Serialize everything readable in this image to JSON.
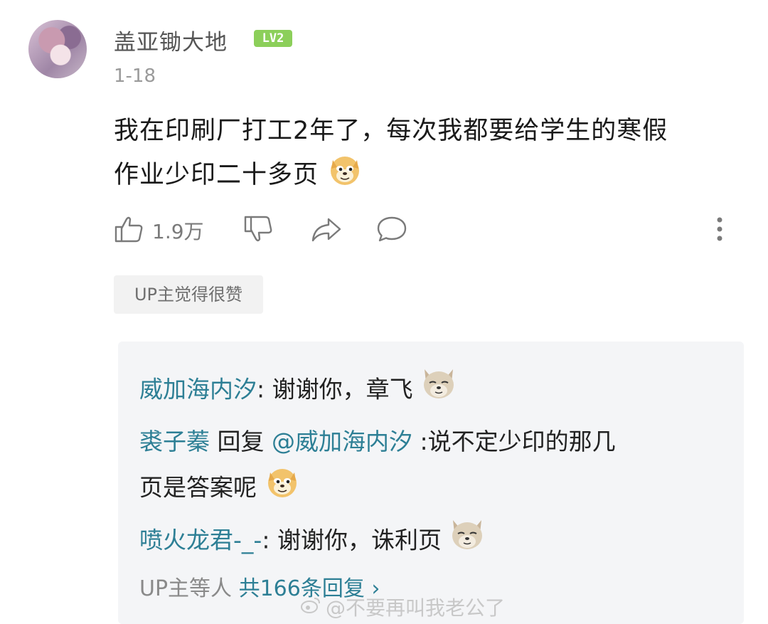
{
  "comment": {
    "username": "盖亚锄大地",
    "level": "LV2",
    "date": "1-18",
    "text_line1": "我在印刷厂打工2年了，每次我都要给学生的寒假",
    "text_line2": "作业少印二十多页",
    "emoji": "doge-emoji"
  },
  "actions": {
    "like_count": "1.9万"
  },
  "up_tag": "UP主觉得很赞",
  "replies": [
    {
      "user": "威加海内汐",
      "separator": ": ",
      "text": "谢谢你，章飞",
      "emoji": "wolf-emoji"
    },
    {
      "user": "裘子蓁",
      "reply_word": " 回复 ",
      "mention": "@威加海内汐",
      "text_line1": " :说不定少印的那几",
      "text_line2": "页是答案呢",
      "emoji": "doge-emoji"
    },
    {
      "user": "喷火龙君-_-",
      "separator": ": ",
      "text": "谢谢你，诛利页",
      "emoji": "wolf-emoji"
    }
  ],
  "more_replies": {
    "prefix": "UP主等人 ",
    "count_text": "共166条回复",
    "chevron": "›"
  },
  "watermark": "@不要再叫我老公了"
}
